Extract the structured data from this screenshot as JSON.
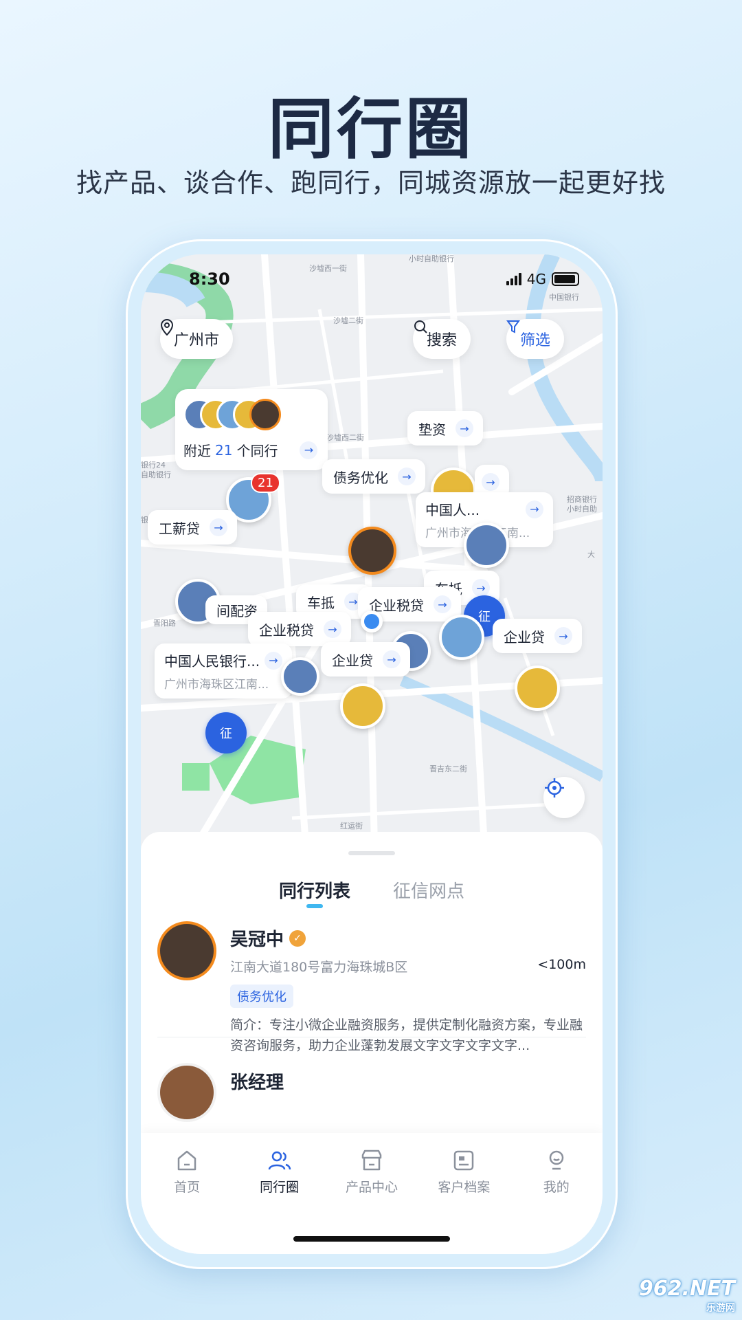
{
  "hero": {
    "title": "同行圈",
    "subtitle": "找产品、谈合作、跑同行，同城资源放一起更好找"
  },
  "status_bar": {
    "time": "8:30",
    "network": "4G"
  },
  "map": {
    "city": "广州市",
    "search_label": "搜索",
    "filter_label": "筛选",
    "nearby": {
      "prefix": "附近",
      "count": "21",
      "suffix": "个同行"
    },
    "cluster_badge": "21",
    "tags": {
      "dianzi": "垫资",
      "zhaiwu": "债务优化",
      "gongxin": "工薪贷",
      "chedi": "车抵",
      "chedi2": "车抵",
      "qyshuidai1": "企业税贷",
      "qyshuidai2": "企业税贷",
      "qydai1": "企业贷",
      "qydai2": "企业贷",
      "peizi": "间配资"
    },
    "banks": {
      "bank_a": {
        "title": "中国人民银行...",
        "sub": "广州市海珠区江南..."
      },
      "bank_b": {
        "title": "中国人...",
        "sub": "广州市海珠区江南..."
      }
    },
    "shield_label": "征",
    "map_labels": {
      "l1": "小时自助银行",
      "l2": "沙墟西一街",
      "l3": "中国银行",
      "l4": "沙墟二街",
      "l5": "沙墟西二街",
      "l6": "招商银行",
      "l7": "小时自助",
      "l8": "晋阳路",
      "l9": "大",
      "l10": "晋吉东二街",
      "l11": "红运街",
      "l12": "银行24",
      "l13": "自助银行",
      "l14": "银行ATM"
    }
  },
  "sheet": {
    "tabs": [
      "同行列表",
      "征信网点"
    ],
    "items": [
      {
        "name": "吴冠中",
        "verified_icon": "verified-badge-icon",
        "address": "江南大道180号富力海珠城B区",
        "distance": "<100m",
        "tag": "债务优化",
        "desc": "简介：专注小微企业融资服务，提供定制化融资方案，专业融资咨询服务，助力企业蓬勃发展文字文字文字文字..."
      },
      {
        "name": "张经理"
      }
    ]
  },
  "tabbar": [
    {
      "label": "首页",
      "icon": "home-icon"
    },
    {
      "label": "同行圈",
      "icon": "peers-icon"
    },
    {
      "label": "产品中心",
      "icon": "store-icon"
    },
    {
      "label": "客户档案",
      "icon": "archive-icon"
    },
    {
      "label": "我的",
      "icon": "profile-icon"
    }
  ],
  "watermark": {
    "brand": "962.NET",
    "sub": "乐游网"
  },
  "colors": {
    "accent": "#2b63e0",
    "orange": "#f38a1d",
    "badge": "#e8332e"
  }
}
